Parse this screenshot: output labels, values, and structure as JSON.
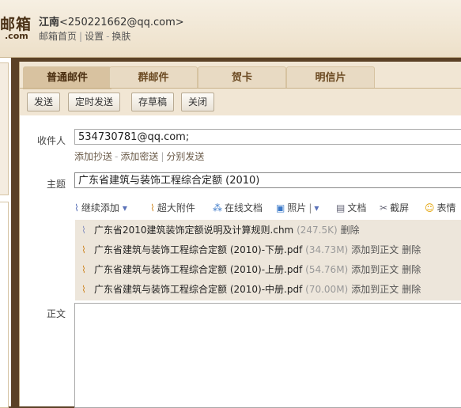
{
  "header": {
    "logo_main": "邮箱",
    "logo_sub": ".com",
    "user_name": "江南",
    "user_email": "<250221662@qq.com>",
    "links": [
      "邮箱首页",
      "设置",
      "换肤"
    ],
    "link_separators": [
      "|",
      "-"
    ]
  },
  "tabs": [
    {
      "label": "普通邮件",
      "active": true
    },
    {
      "label": "群邮件",
      "active": false
    },
    {
      "label": "贺卡",
      "active": false
    },
    {
      "label": "明信片",
      "active": false
    }
  ],
  "actions": {
    "send": "发送",
    "scheduled_send": "定时发送",
    "save_draft": "存草稿",
    "close": "关闭"
  },
  "compose": {
    "to_label": "收件人",
    "to_value": "534730781@qq.com;",
    "add_cc": "添加抄送",
    "add_bcc": "添加密送",
    "separate_send": "分别发送",
    "sublink_seps": [
      "-",
      "|"
    ],
    "subject_label": "主题",
    "subject_value": "广东省建筑与装饰工程综合定额 (2010)",
    "body_label": "正文"
  },
  "toolbar": {
    "continue_add": "继续添加",
    "large_attachment": "超大附件",
    "online_doc": "在线文档",
    "photo": "照片",
    "document": "文档",
    "screenshot": "截屏",
    "emoticon": "表情"
  },
  "attachments": [
    {
      "name": "广东省2010建筑装饰定额说明及计算规则.chm",
      "size": "(247.5K)",
      "actions": [
        "删除"
      ],
      "icon": "paperclip-icon"
    },
    {
      "name": "广东省建筑与装饰工程综合定额 (2010)-下册.pdf",
      "size": "(34.73M)",
      "actions": [
        "添加到正文",
        "删除"
      ],
      "icon": "paperclip-icon"
    },
    {
      "name": "广东省建筑与装饰工程综合定额 (2010)-上册.pdf",
      "size": "(54.76M)",
      "actions": [
        "添加到正文",
        "删除"
      ],
      "icon": "paperclip-icon"
    },
    {
      "name": "广东省建筑与装饰工程综合定额 (2010)-中册.pdf",
      "size": "(70.00M)",
      "actions": [
        "添加到正文",
        "删除"
      ],
      "icon": "paperclip-icon"
    }
  ],
  "colors": {
    "frame_brown": "#5b4126",
    "tab_active": "#d8c2a0",
    "attach_bg": "#ede6db",
    "link_blue": "#2a5db0"
  }
}
